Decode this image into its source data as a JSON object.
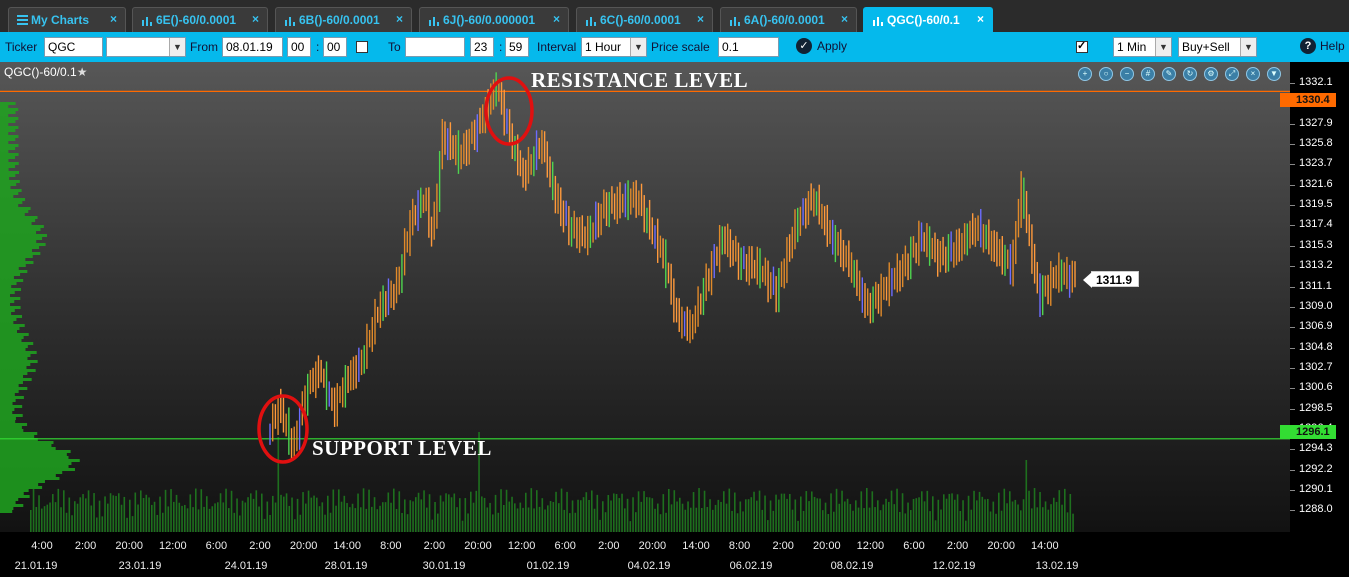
{
  "tabs": [
    {
      "label": "My Charts",
      "kind": "list"
    },
    {
      "label": "6E()-60/0.0001",
      "kind": "chart"
    },
    {
      "label": "6B()-60/0.0001",
      "kind": "chart"
    },
    {
      "label": "6J()-60/0.000001",
      "kind": "chart"
    },
    {
      "label": "6C()-60/0.0001",
      "kind": "chart"
    },
    {
      "label": "6A()-60/0.0001",
      "kind": "chart"
    },
    {
      "label": "QGC()-60/0.1",
      "kind": "chart",
      "active": true
    }
  ],
  "tab_close_glyph": "×",
  "toolbar": {
    "ticker_label": "Ticker",
    "ticker_value": "QGC",
    "from_label": "From",
    "from_date": "08.01.19",
    "from_hour": "00",
    "from_min": "00",
    "time_sep": ":",
    "to_label": "To",
    "to_date": "",
    "to_hour": "23",
    "to_min": "59",
    "interval_label": "Interval",
    "interval_value": "1 Hour",
    "price_scale_label": "Price scale",
    "price_scale_value": "0.1",
    "apply_label": "Apply",
    "mode_value": "1 Min",
    "side_value": "Buy+Sell",
    "help_label": "Help",
    "auto_glyph": "A"
  },
  "chart": {
    "title": "QGC()-60/0.1",
    "star": "★",
    "resistance_text": "RESISTANCE LEVEL",
    "support_text": "SUPPORT LEVEL",
    "resistance_price": "1330.4",
    "support_price": "1296.1",
    "last_price": "1311.9",
    "colors": {
      "resistance": "#ff6a00",
      "support": "#33dd33",
      "up": "#e08a2a",
      "down": "#ff9a3c",
      "volume": "#1f7a1f",
      "profile": "#1ea51e"
    }
  },
  "chart_data": {
    "type": "bar",
    "title": "QGC()-60/0.1",
    "xlabel": "",
    "ylabel": "",
    "ylim": [
      1287,
      1333
    ],
    "y_ticks": [
      "1332.1",
      "1330.0",
      "1327.9",
      "1325.8",
      "1323.7",
      "1321.6",
      "1319.5",
      "1317.4",
      "1315.3",
      "1313.2",
      "1311.1",
      "1309.0",
      "1306.9",
      "1304.8",
      "1302.7",
      "1300.6",
      "1298.5",
      "1296.4",
      "1294.3",
      "1292.2",
      "1290.1",
      "1288.0"
    ],
    "x_time_ticks": [
      "4:00",
      "2:00",
      "20:00",
      "12:00",
      "6:00",
      "2:00",
      "20:00",
      "14:00",
      "8:00",
      "2:00",
      "20:00",
      "12:00",
      "6:00",
      "2:00",
      "20:00",
      "14:00",
      "8:00",
      "2:00",
      "20:00",
      "12:00",
      "6:00",
      "2:00",
      "20:00",
      "14:00"
    ],
    "x_date_ticks": [
      "21.01.19",
      "23.01.19",
      "24.01.19",
      "28.01.19",
      "30.01.19",
      "01.02.19",
      "04.02.19",
      "06.02.19",
      "08.02.19",
      "12.02.19",
      "13.02.19"
    ],
    "horizontal_lines": [
      {
        "name": "resistance",
        "value": 1330.4
      },
      {
        "name": "support",
        "value": 1296.1
      }
    ],
    "last_value": 1311.9,
    "price_path": [
      [
        0.0,
        1297.0
      ],
      [
        0.02,
        1299.5
      ],
      [
        0.05,
        1295.0
      ],
      [
        0.08,
        1301.0
      ],
      [
        0.11,
        1303.0
      ],
      [
        0.14,
        1299.0
      ],
      [
        0.17,
        1302.0
      ],
      [
        0.2,
        1303.5
      ],
      [
        0.24,
        1309.0
      ],
      [
        0.28,
        1311.0
      ],
      [
        0.31,
        1317.5
      ],
      [
        0.34,
        1320.0
      ],
      [
        0.36,
        1316.0
      ],
      [
        0.38,
        1326.0
      ],
      [
        0.42,
        1324.0
      ],
      [
        0.46,
        1327.0
      ],
      [
        0.5,
        1331.0
      ],
      [
        0.53,
        1326.0
      ],
      [
        0.56,
        1322.0
      ],
      [
        0.6,
        1325.5
      ],
      [
        0.63,
        1320.0
      ],
      [
        0.66,
        1317.0
      ],
      [
        0.7,
        1316.0
      ],
      [
        0.74,
        1319.0
      ],
      [
        0.78,
        1319.5
      ],
      [
        0.81,
        1320.0
      ],
      [
        0.84,
        1317.0
      ],
      [
        0.87,
        1314.0
      ],
      [
        0.9,
        1308.0
      ],
      [
        0.93,
        1307.0
      ],
      [
        0.96,
        1311.0
      ],
      [
        1.0,
        1316.0
      ],
      [
        1.04,
        1313.5
      ],
      [
        1.08,
        1313.0
      ],
      [
        1.12,
        1310.5
      ],
      [
        1.16,
        1317.0
      ],
      [
        1.2,
        1320.0
      ],
      [
        1.24,
        1316.0
      ],
      [
        1.28,
        1313.5
      ],
      [
        1.32,
        1309.0
      ],
      [
        1.36,
        1311.0
      ],
      [
        1.4,
        1313.0
      ],
      [
        1.44,
        1316.0
      ],
      [
        1.48,
        1314.0
      ],
      [
        1.52,
        1315.0
      ],
      [
        1.56,
        1317.0
      ],
      [
        1.6,
        1315.0
      ],
      [
        1.64,
        1313.0
      ],
      [
        1.66,
        1321.0
      ],
      [
        1.7,
        1310.0
      ],
      [
        1.74,
        1312.5
      ],
      [
        1.78,
        1311.9
      ]
    ]
  }
}
